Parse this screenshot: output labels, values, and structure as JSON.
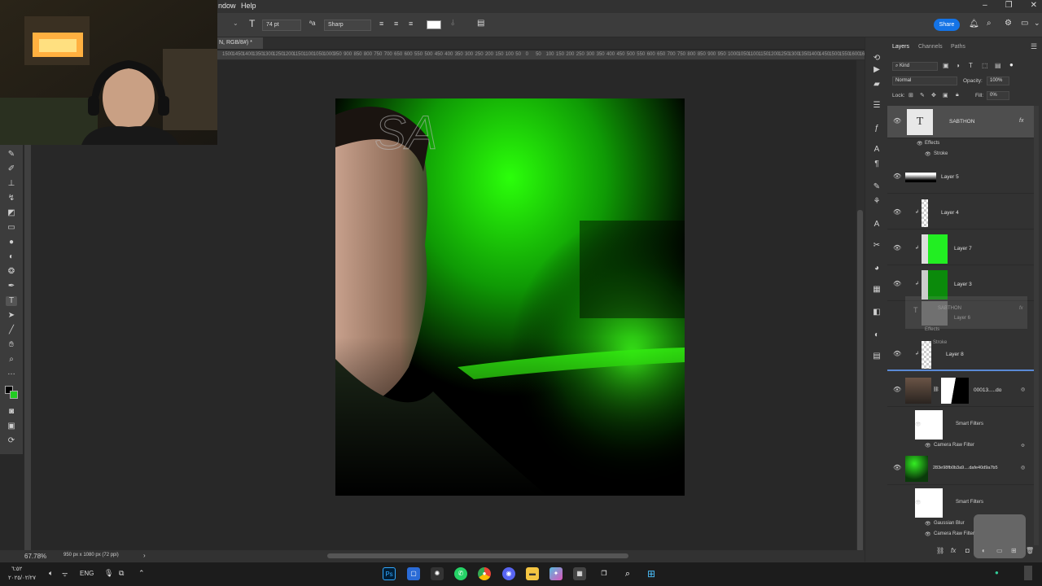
{
  "menu": {
    "window": "ndow",
    "help": "Help"
  },
  "options": {
    "font_size": "74 pt",
    "antialias": "Sharp",
    "share": "Share"
  },
  "document": {
    "tab_title": "N, RGB/8#) *",
    "ruler_ticks": [
      "1500",
      "1450",
      "1400",
      "1350",
      "1300",
      "1250",
      "1200",
      "1150",
      "1100",
      "1050",
      "1000",
      "950",
      "900",
      "850",
      "800",
      "750",
      "700",
      "650",
      "600",
      "550",
      "500",
      "450",
      "400",
      "350",
      "300",
      "250",
      "200",
      "150",
      "100",
      "50",
      "0",
      "50",
      "100",
      "150",
      "200",
      "250",
      "300",
      "350",
      "400",
      "450",
      "500",
      "550",
      "600",
      "650",
      "700",
      "750",
      "800",
      "850",
      "900",
      "950",
      "1000",
      "1050",
      "1100",
      "1150",
      "1200",
      "1250",
      "1300",
      "1350",
      "1400",
      "1450",
      "1500",
      "1550",
      "1600",
      "1650"
    ],
    "canvas_text": "SA"
  },
  "status": {
    "zoom": "67.78%",
    "dimensions": "950 px x 1080 px (72 ppi)",
    "arrow": "›"
  },
  "layers_panel": {
    "tabs": [
      "Layers",
      "Channels",
      "Paths"
    ],
    "filter_kind": "Kind",
    "blend_mode": "Normal",
    "opacity_label": "Opacity:",
    "opacity_value": "100%",
    "lock_label": "Lock:",
    "fill_label": "Fill:",
    "fill_value": "0%",
    "layers": [
      {
        "name": "SABTHON",
        "kind": "text",
        "fx": "fx",
        "effects": "Effects",
        "effect_items": [
          "Stroke"
        ]
      },
      {
        "name": "Layer 5",
        "kind": "gradient"
      },
      {
        "name": "Layer 4",
        "kind": "transparent"
      },
      {
        "name": "Layer 7",
        "kind": "green"
      },
      {
        "name": "Layer 3",
        "kind": "darkgreen"
      },
      {
        "name": "Layer 8",
        "kind": "transparent"
      },
      {
        "name": "00013.....do",
        "kind": "photo-mask",
        "smart_filters": "Smart Filters",
        "filters": [
          "Camera Raw Filter"
        ]
      },
      {
        "name": "283e98fb0b3a9....dafe40d9a7b5",
        "kind": "green-photo",
        "smart_filters": "Smart Filters",
        "filters": [
          "Gaussian Blur",
          "Camera Raw Filter"
        ]
      }
    ],
    "drag_ghost": {
      "name": "SABTHON",
      "sub": "Layer 6",
      "effects": "Effects",
      "stroke": "Stroke",
      "fx": "fx"
    }
  },
  "taskbar": {
    "time": "٦:٥٢",
    "date": "٢٠٢٥/٠٢/٢٧",
    "language": "ENG",
    "apps": [
      "photoshop",
      "explorer-window",
      "chatgpt",
      "whatsapp",
      "chrome",
      "discord",
      "folder",
      "copilot",
      "store",
      "taskview",
      "search",
      "windows"
    ]
  },
  "colors": {
    "accent": "#1473e6",
    "canvas_bg": "#282828",
    "panel_bg": "#323232",
    "green_glow": "#22e000",
    "foreground_swatch": "#000000",
    "background_swatch": "#22cc22"
  }
}
